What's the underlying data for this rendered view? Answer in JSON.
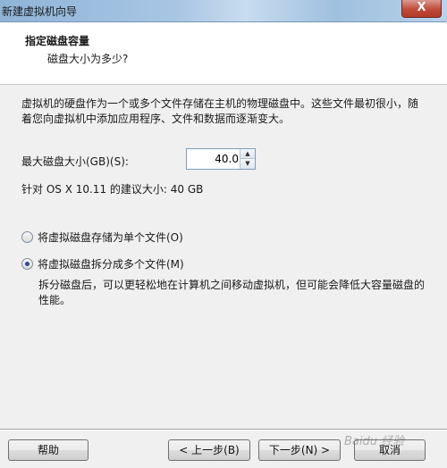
{
  "window": {
    "title": "新建虚拟机向导",
    "close_glyph": "X"
  },
  "header": {
    "title": "指定磁盘容量",
    "subtitle": "磁盘大小为多少?"
  },
  "body": {
    "description": "虚拟机的硬盘作为一个或多个文件存储在主机的物理磁盘中。这些文件最初很小，随着您向虚拟机中添加应用程序、文件和数据而逐渐变大。",
    "max_size_label": "最大磁盘大小(GB)(S):",
    "max_size_value": "40.0",
    "recommendation": "针对 OS X 10.11 的建议大小: 40 GB",
    "options": [
      {
        "label": "将虚拟磁盘存储为单个文件(O)",
        "selected": false
      },
      {
        "label": "将虚拟磁盘拆分成多个文件(M)",
        "selected": true
      }
    ],
    "split_hint": "拆分磁盘后，可以更轻松地在计算机之间移动虚拟机，但可能会降低大容量磁盘的性能。"
  },
  "footer": {
    "help": "帮助",
    "back": "< 上一步(B)",
    "next": "下一步(N) >",
    "cancel": "取消"
  },
  "watermark": "Baidu 经验"
}
